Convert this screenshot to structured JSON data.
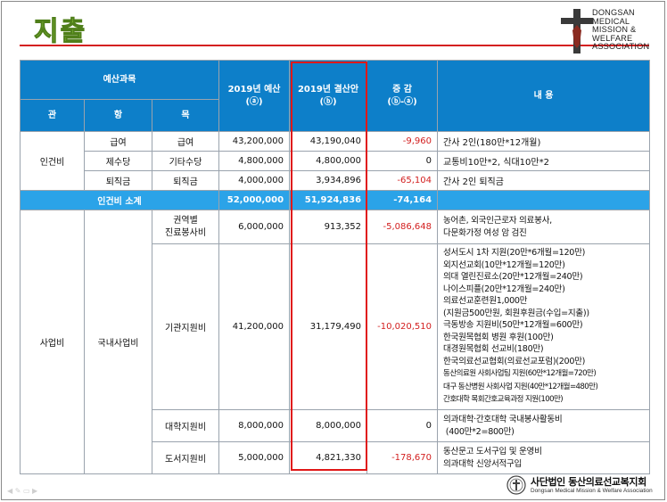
{
  "page_title": "지출",
  "org_logo": {
    "lines": [
      "DONGSAN",
      "MEDICAL",
      "MISSION &",
      "WELFARE",
      "ASSOCIATION"
    ]
  },
  "table": {
    "header": {
      "category": "예산과목",
      "budget": "2019년 예산",
      "budget_mark": "(ⓐ)",
      "settlement": "2019년 결산안",
      "settlement_mark": "(ⓑ)",
      "diff": "증  감",
      "diff_mark": "(ⓑ-ⓐ)",
      "content": "내    용",
      "gwan": "관",
      "hang": "항",
      "mok": "목"
    },
    "personnel": {
      "gwan": "인건비",
      "rows": [
        {
          "hang": "급여",
          "mok": "급여",
          "budget": "43,200,000",
          "settlement": "43,190,040",
          "diff": "-9,960",
          "content": "간사 2인(180만*12개월)"
        },
        {
          "hang": "제수당",
          "mok": "기타수당",
          "budget": "4,800,000",
          "settlement": "4,800,000",
          "diff": "0",
          "content": "교통비10만*2, 식대10만*2"
        },
        {
          "hang": "퇴직금",
          "mok": "퇴직금",
          "budget": "4,000,000",
          "settlement": "3,934,896",
          "diff": "-65,104",
          "content": "간사 2인 퇴직금"
        }
      ],
      "subtotal": {
        "label": "인건비 소계",
        "budget": "52,000,000",
        "settlement": "51,924,836",
        "diff": "-74,164"
      }
    },
    "business": {
      "gwan": "사업비",
      "hang": "국내사업비",
      "rows": [
        {
          "mok_lines": [
            "권역별",
            "진료봉사비"
          ],
          "budget": "6,000,000",
          "settlement": "913,352",
          "diff": "-5,086,648",
          "content_lines": [
            "농어촌, 외국인근로자 의료봉사,",
            "다문화가정 여성 암 검진"
          ]
        },
        {
          "mok_lines": [
            "기관지원비"
          ],
          "budget": "41,200,000",
          "settlement": "31,179,490",
          "diff": "-10,020,510",
          "content_lines": [
            "성서도시 1차 지원(20만*6개월=120만)",
            "외지선교회(10만*12개월=120만)",
            "의대 열린진료소(20만*12개월=240만)",
            "나이스피플(20만*12개월=240만)",
            "의료선교훈련원1,000만",
            "(지원금500만원, 회원후원금(수입=지출))",
            "극동방송 지원비(50만*12개월=600만)",
            "한국원목협회 병원 후원(100만)",
            "대경원목협회 선교비(180만)",
            "한국의료선교협회(의료선교포럼)(200만)",
            "동산의료원 사회사업팀 지원(60만*12개월=720만)",
            "대구 동산병원 사회사업 지원(40만*12개월=480만)",
            "간호대학 목회간호교육과정 지원(100만)"
          ]
        },
        {
          "mok_lines": [
            "대학지원비"
          ],
          "budget": "8,000,000",
          "settlement": "8,000,000",
          "diff": "0",
          "content_lines": [
            "의과대학·간호대학 국내봉사활동비",
            "(400만*2=800만)"
          ]
        },
        {
          "mok_lines": [
            "도서지원비"
          ],
          "budget": "5,000,000",
          "settlement": "4,821,330",
          "diff": "-178,670",
          "content_lines": [
            "동산문고 도서구입 및 운영비",
            "의과대학 신앙서적구입"
          ]
        }
      ]
    }
  },
  "footer": {
    "org_ko": "사단법인 동산의료선교복지회",
    "org_en": "Dongsan Medical Mission & Welfare Association"
  },
  "colors": {
    "header": "#0d7fc9",
    "subtotal": "#2ba3e8",
    "negative": "#d32020",
    "highlight": "#e01818",
    "title": "#8cc63f"
  }
}
